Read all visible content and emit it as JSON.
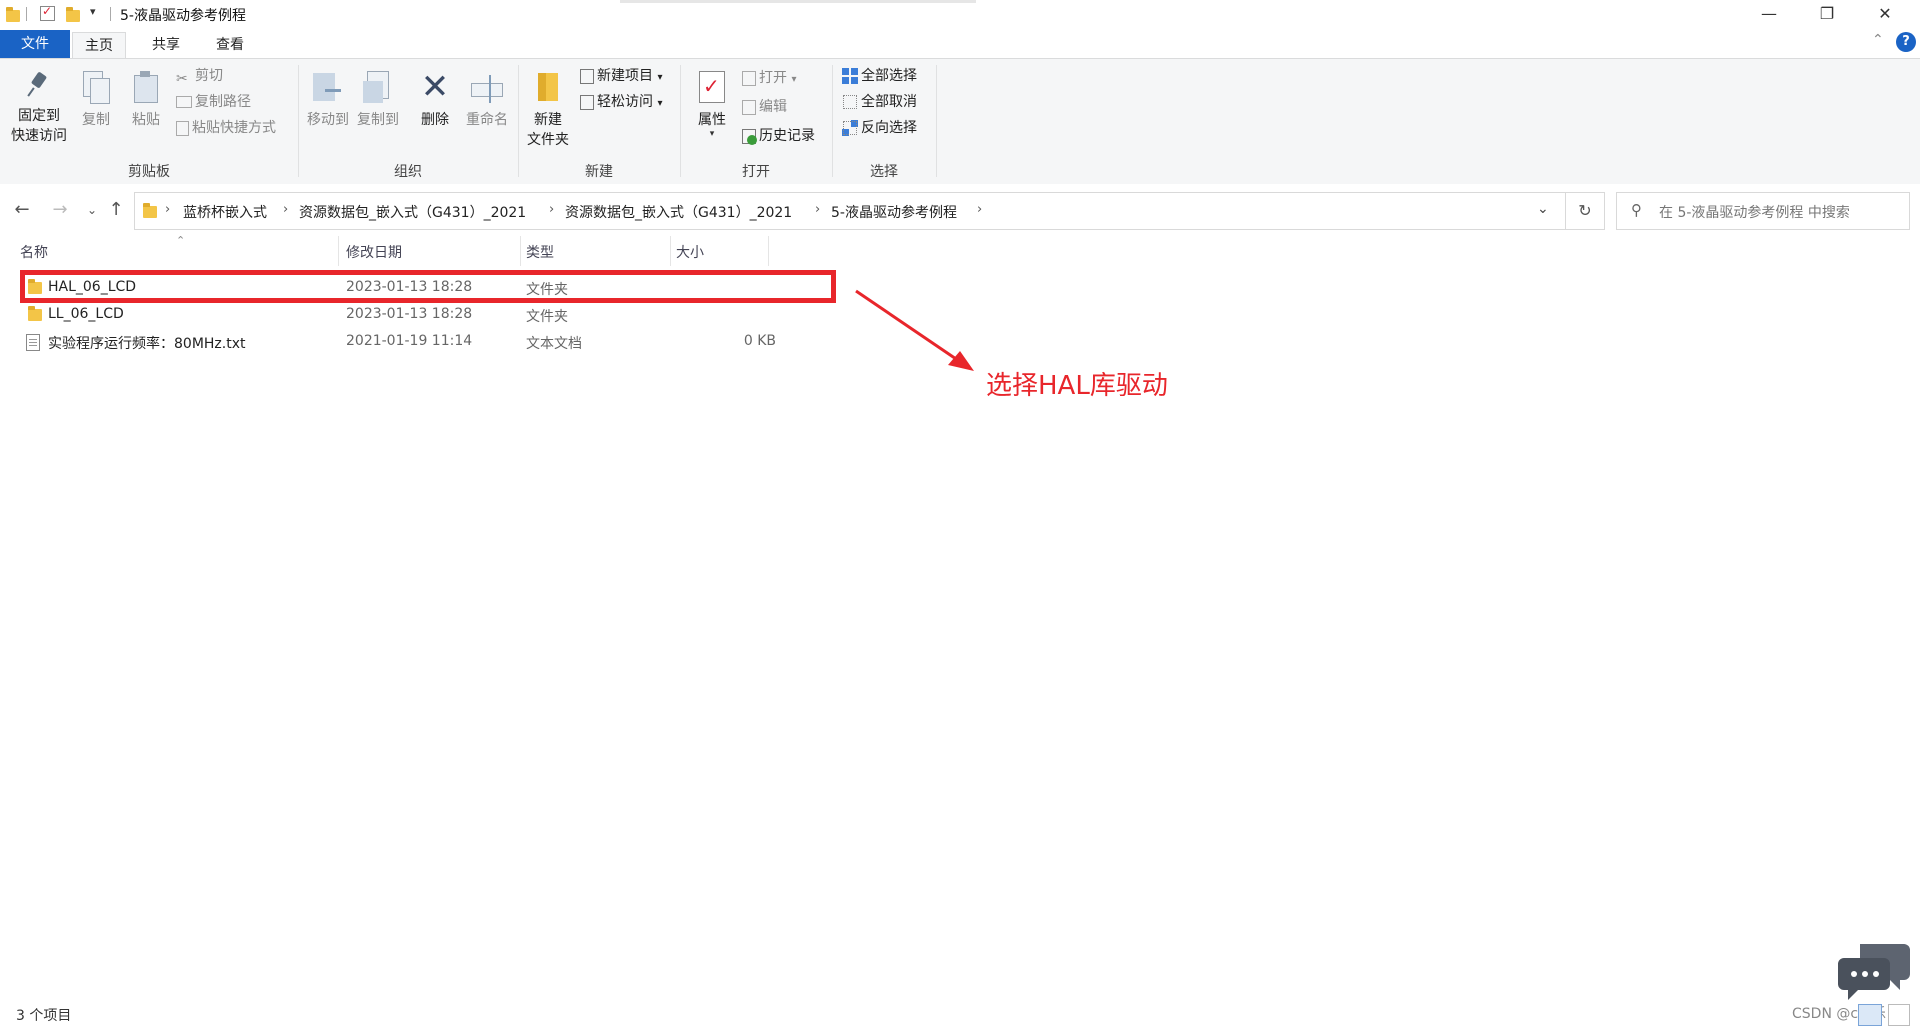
{
  "window": {
    "title": "5-液晶驱动参考例程",
    "minimize": "—",
    "restore": "❐",
    "close": "✕"
  },
  "tabs": {
    "file": "文件",
    "home": "主页",
    "share": "共享",
    "view": "查看"
  },
  "ribbon": {
    "clipboard": {
      "pin": "固定到\n快速访问",
      "pin_line1": "固定到",
      "pin_line2": "快速访问",
      "copy": "复制",
      "paste": "粘贴",
      "cut": "剪切",
      "copy_path": "复制路径",
      "paste_shortcut": "粘贴快捷方式",
      "label": "剪贴板"
    },
    "organize": {
      "move_to": "移动到",
      "copy_to": "复制到",
      "delete": "删除",
      "rename": "重命名",
      "label": "组织"
    },
    "new": {
      "new_folder_line1": "新建",
      "new_folder_line2": "文件夹",
      "new_item": "新建项目",
      "easy_access": "轻松访问",
      "label": "新建"
    },
    "open": {
      "properties": "属性",
      "open": "打开",
      "edit": "编辑",
      "history": "历史记录",
      "label": "打开"
    },
    "select": {
      "select_all": "全部选择",
      "select_none": "全部取消",
      "invert": "反向选择",
      "label": "选择"
    }
  },
  "address": {
    "crumbs": [
      "蓝桥杯嵌入式",
      "资源数据包_嵌入式（G431）_2021",
      "资源数据包_嵌入式（G431）_2021",
      "5-液晶驱动参考例程"
    ],
    "search_placeholder": "在 5-液晶驱动参考例程 中搜索"
  },
  "columns": {
    "name": "名称",
    "modified": "修改日期",
    "type": "类型",
    "size": "大小"
  },
  "files": [
    {
      "name": "HAL_06_LCD",
      "modified": "2023-01-13 18:28",
      "type": "文件夹",
      "size": ""
    },
    {
      "name": "LL_06_LCD",
      "modified": "2023-01-13 18:28",
      "type": "文件夹",
      "size": ""
    },
    {
      "name": "实验程序运行频率：80MHz.txt",
      "modified": "2021-01-19 11:14",
      "type": "文本文档",
      "size": "0 KB"
    }
  ],
  "annotation": "选择HAL库驱动",
  "status": "3 个项目",
  "watermark": "CSDN @c快乐"
}
